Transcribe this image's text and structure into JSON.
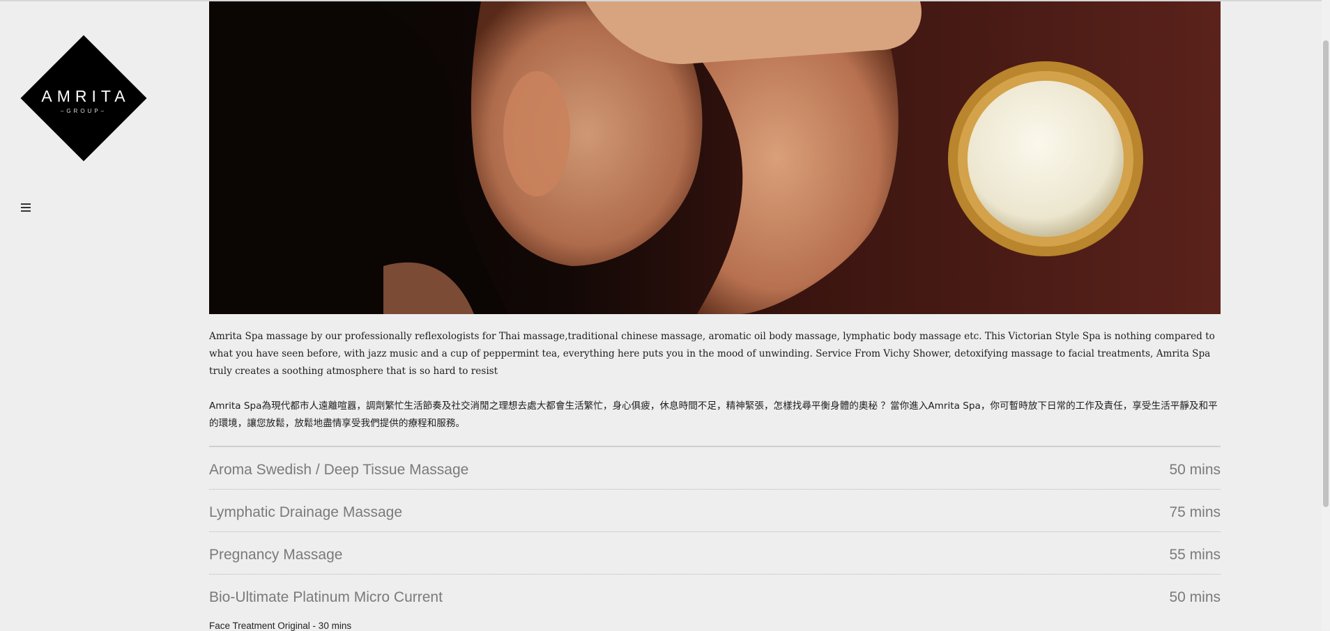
{
  "brand": {
    "name": "AMRITA",
    "sub": "GROUP"
  },
  "menu_icon": "hamburger-menu-icon",
  "hero_image": "Woman lying face-down on a dark red sheet, eyes closed, beside a bowl of white massage cream",
  "intro": {
    "english": "Amrita Spa massage by our professionally reflexologists for Thai massage,traditional chinese massage, aromatic oil body massage, lymphatic body massage etc.  This Victorian Style Spa is nothing compared to what you have seen before, with jazz music and a cup of peppermint tea, everything here puts you in the mood of unwinding.  Service From Vichy Shower, detoxifying massage to facial treatments, Amrita Spa truly creates a soothing atmosphere that is so hard to resist",
    "chinese": "Amrita Spa為現代都市人遠離喧囂，調劑繁忙生活節奏及社交消閒之理想去處大都會生活繁忙，身心俱疲，休息時間不足，精神緊張，怎樣找尋平衡身體的奧秘 ？當你進入Amrita Spa，你可暫時放下日常的工作及責任，享受生活平靜及和平的環境，讓您放鬆，放鬆地盡情享受我們提供的療程和服務。"
  },
  "services": [
    {
      "name": "Aroma Swedish / Deep Tissue Massage",
      "duration": "50 mins"
    },
    {
      "name": "Lymphatic Drainage Massage",
      "duration": "75 mins"
    },
    {
      "name": "Pregnancy Massage",
      "duration": "55 mins"
    },
    {
      "name": "Bio-Ultimate Platinum Micro Current",
      "duration": "50 mins"
    }
  ],
  "service_sub": "Face Treatment Original  - 30 mins",
  "colors": {
    "background": "#efeeee",
    "logo": "#000000",
    "service_text": "#7a7a7a"
  }
}
